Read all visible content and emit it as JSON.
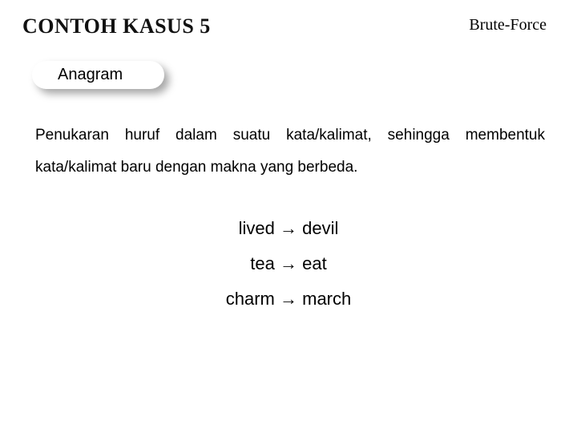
{
  "header": {
    "title": "CONTOH KASUS 5",
    "topic": "Brute-Force"
  },
  "sub_badge": "Anagram",
  "body": "Penukaran huruf dalam suatu kata/kalimat, sehingga membentuk kata/kalimat baru dengan makna yang berbeda.",
  "arrow": "→",
  "examples": [
    {
      "from": "lived",
      "to": "devil"
    },
    {
      "from": "tea",
      "to": "eat"
    },
    {
      "from": "charm",
      "to": "march"
    }
  ]
}
